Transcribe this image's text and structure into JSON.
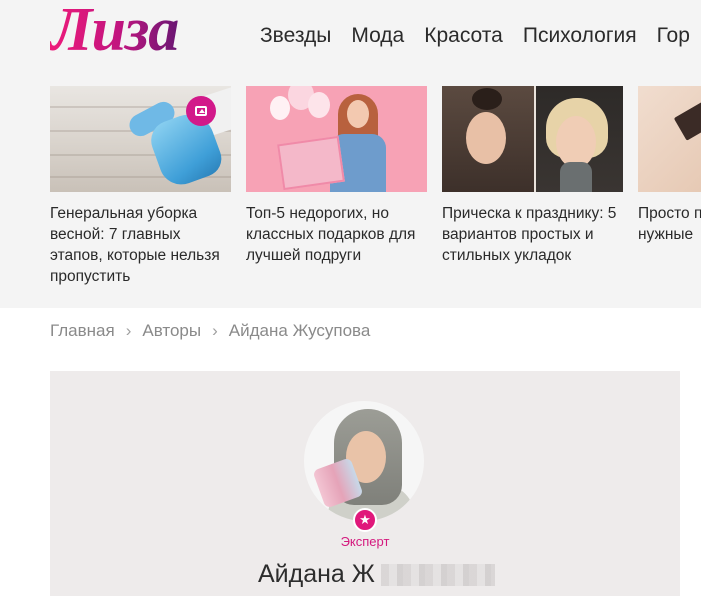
{
  "header": {
    "logo_text": "Лиза",
    "nav": [
      "Звезды",
      "Мода",
      "Красота",
      "Психология",
      "Гор"
    ]
  },
  "cards": [
    {
      "title": "Генеральная уборка весной: 7 главных этапов, которые нельзя пропустить",
      "badge": "gallery-icon"
    },
    {
      "title": "Топ-5 недорогих, но классных подарков для лучшей подруги"
    },
    {
      "title": "Прическа к празднику: 5 вариантов простых и стильных укладок"
    },
    {
      "title": "Просто п лучшие, нужные"
    }
  ],
  "breadcrumb": [
    "Главная",
    "Авторы",
    "Айдана Жусупова"
  ],
  "author": {
    "badge_label": "Эксперт",
    "name_visible": "Айдана Ж"
  },
  "colors": {
    "accent": "#e0187b",
    "band": "#f4f4f4",
    "author_bg": "#eeebeb"
  }
}
